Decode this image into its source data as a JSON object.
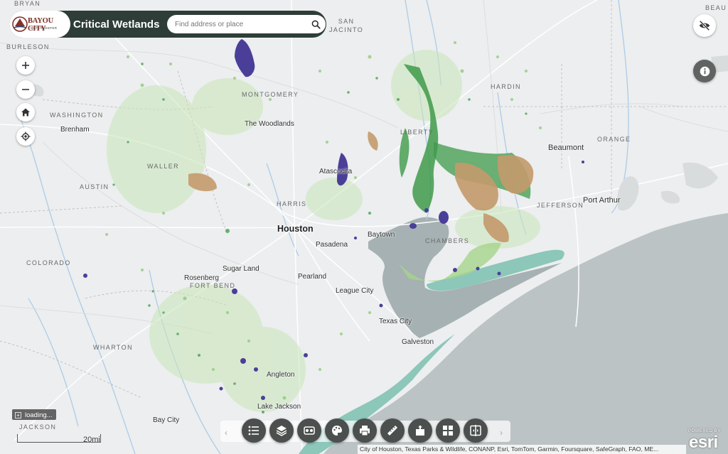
{
  "app": {
    "title": "Critical Wetlands",
    "logo_text": "BAYOU CITY",
    "logo_subtext": "WATERKEEPER"
  },
  "search": {
    "placeholder": "Find address or place",
    "icon": "search-icon"
  },
  "map_controls": {
    "zoom_in": "+",
    "zoom_out": "−",
    "home_icon": "home-icon",
    "locate_icon": "locate-icon",
    "visibility_icon": "eye-off-icon",
    "info_icon": "info-icon"
  },
  "labels": {
    "counties": [
      "BRYAN",
      "SAN JACINTO",
      "BURLESON",
      "MONTGOMERY",
      "HARDIN",
      "WASHINGTON",
      "LIBERTY",
      "ORANGE",
      "WALLER",
      "AUSTIN",
      "HARRIS",
      "JEFFERSON",
      "CHAMBERS",
      "COLORADO",
      "FORT BEND",
      "WHARTON",
      "JACKSON",
      "BEAU"
    ],
    "cities": [
      "The Woodlands",
      "Brenham",
      "Atascocita",
      "Beaumont",
      "Port Arthur",
      "Baytown",
      "Pasadena",
      "Sugar Land",
      "Rosenberg",
      "Pearland",
      "League City",
      "Texas City",
      "Galveston",
      "Angleton",
      "Lake Jackson",
      "Bay City"
    ],
    "major_city": "Houston"
  },
  "toolbar": {
    "tools": [
      {
        "name": "legend-tool",
        "icon": "list-icon"
      },
      {
        "name": "layers-tool",
        "icon": "layers-icon"
      },
      {
        "name": "basemap-tool",
        "icon": "basemap-icon"
      },
      {
        "name": "style-tool",
        "icon": "palette-icon"
      },
      {
        "name": "print-tool",
        "icon": "print-icon"
      },
      {
        "name": "measure-tool",
        "icon": "ruler-icon"
      },
      {
        "name": "share-tool",
        "icon": "share-icon"
      },
      {
        "name": "grid-tool",
        "icon": "grid-icon"
      },
      {
        "name": "compare-tool",
        "icon": "split-icon"
      }
    ]
  },
  "status": {
    "loading": "loading..."
  },
  "scale": {
    "label": "20mi"
  },
  "attribution": "City of Houston, Texas Parks & Wildlife, CONANP, Esri, TomTom, Garmin, Foursquare, SafeGraph, FAO, ME...",
  "esri": {
    "powered_by": "POWERED BY",
    "brand": "esri"
  },
  "colors": {
    "land": "#eceeef",
    "water": "#b5bebf",
    "bay": "#9aa7a9",
    "wetland_forest": "#3d9b4a",
    "wetland_emergent": "#9ccf6e",
    "wetland_shrub": "#c7e3b0",
    "wetland_ag": "#c49a6c",
    "wetland_pond": "#4a3f98",
    "wetland_estuary": "#8cc7b9",
    "header_bg": "#2e3d38",
    "tool_bg": "#4b4f4d"
  }
}
